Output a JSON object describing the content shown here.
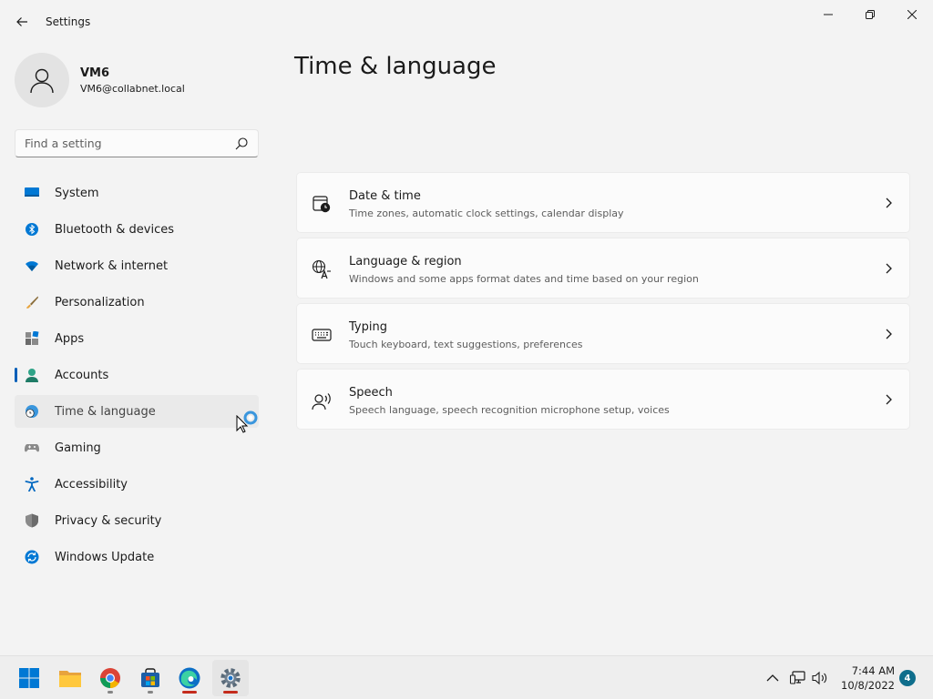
{
  "app": {
    "title": "Settings"
  },
  "profile": {
    "name": "VM6",
    "email": "VM6@collabnet.local"
  },
  "search": {
    "placeholder": "Find a setting",
    "value": ""
  },
  "nav": {
    "items": [
      {
        "label": "System",
        "icon": "monitor-icon"
      },
      {
        "label": "Bluetooth & devices",
        "icon": "bluetooth-icon"
      },
      {
        "label": "Network & internet",
        "icon": "wifi-icon"
      },
      {
        "label": "Personalization",
        "icon": "paintbrush-icon"
      },
      {
        "label": "Apps",
        "icon": "apps-icon"
      },
      {
        "label": "Accounts",
        "icon": "person-icon"
      },
      {
        "label": "Time & language",
        "icon": "globe-clock-icon",
        "selected": true
      },
      {
        "label": "Gaming",
        "icon": "gamepad-icon"
      },
      {
        "label": "Accessibility",
        "icon": "accessibility-icon"
      },
      {
        "label": "Privacy & security",
        "icon": "shield-icon"
      },
      {
        "label": "Windows Update",
        "icon": "update-icon"
      }
    ]
  },
  "main": {
    "title": "Time & language",
    "cards": [
      {
        "title": "Date & time",
        "desc": "Time zones, automatic clock settings, calendar display",
        "icon": "calendar-clock-icon"
      },
      {
        "title": "Language & region",
        "desc": "Windows and some apps format dates and time based on your region",
        "icon": "language-icon"
      },
      {
        "title": "Typing",
        "desc": "Touch keyboard, text suggestions, preferences",
        "icon": "keyboard-icon"
      },
      {
        "title": "Speech",
        "desc": "Speech language, speech recognition microphone setup, voices",
        "icon": "speech-icon"
      }
    ]
  },
  "taskbar": {
    "apps": [
      "start-icon",
      "file-explorer-icon",
      "chrome-icon",
      "store-icon",
      "edge-icon",
      "settings-icon"
    ],
    "clock": {
      "time": "7:44 AM",
      "date": "10/8/2022"
    },
    "notifications": "4"
  },
  "colors": {
    "accent": "#005fb8",
    "background": "#f3f3f3",
    "card": "#fbfbfb"
  }
}
